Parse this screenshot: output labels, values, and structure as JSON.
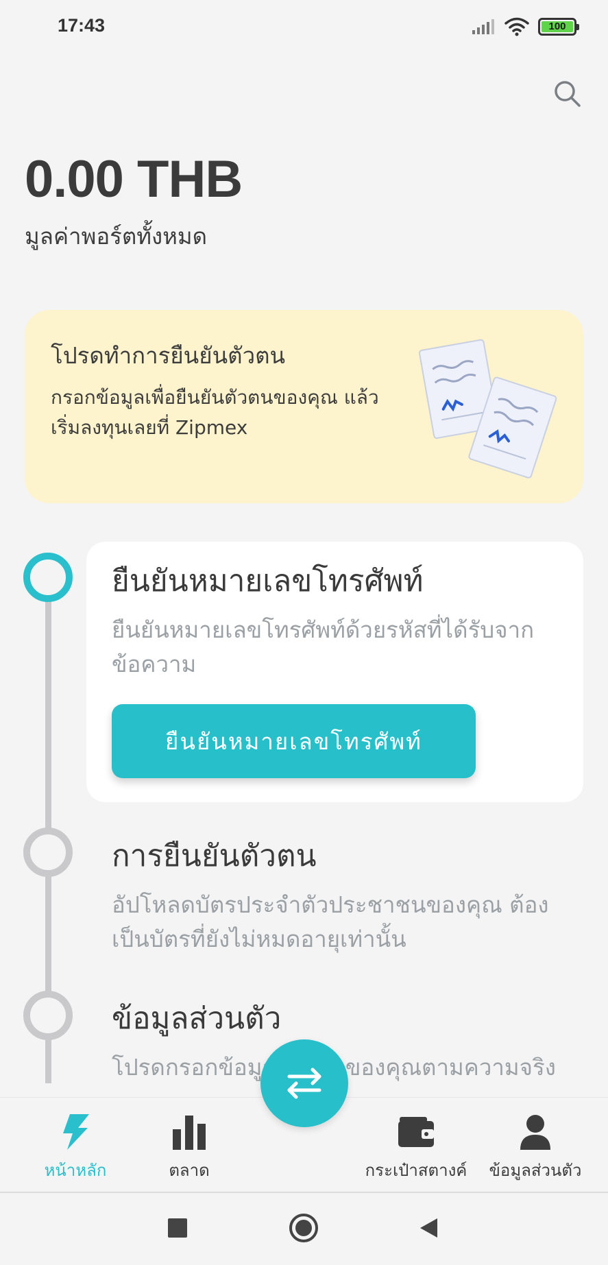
{
  "status_bar": {
    "time": "17:43",
    "battery": "100",
    "icons": [
      "signal-icon",
      "wifi-icon",
      "battery-icon"
    ]
  },
  "header": {
    "search_icon": "search-icon"
  },
  "portfolio": {
    "balance": "0.00 THB",
    "label": "มูลค่าพอร์ตทั้งหมด"
  },
  "kyc_banner": {
    "title": "โปรดทำการยืนยันตัวตน",
    "description": "กรอกข้อมูลเพื่อยืนยันตัวตนของคุณ แล้วเริ่มลงทุนเลยที่ Zipmex",
    "illustration": "documents-icon"
  },
  "steps": [
    {
      "title": "ยืนยันหมายเลขโทรศัพท์",
      "description": "ยืนยันหมายเลขโทรศัพท์ด้วยรหัสที่ได้รับจากข้อความ",
      "button_label": "ยืนยันหมายเลขโทรศัพท์",
      "active": true
    },
    {
      "title": "การยืนยันตัวตน",
      "description": "อัปโหลดบัตรประจำตัวประชาชนของคุณ ต้องเป็นบัตรที่ยังไม่หมดอายุเท่านั้น",
      "active": false
    },
    {
      "title": "ข้อมูลส่วนตัว",
      "description": "โปรดกรอกข้อมูลส่วนตัวของคุณตามความจริง",
      "active": false
    }
  ],
  "bottom_nav": {
    "items": [
      {
        "label": "หน้าหลัก",
        "icon": "lightning-icon",
        "active": true
      },
      {
        "label": "ตลาด",
        "icon": "bar-chart-icon",
        "active": false
      },
      {
        "label": "กระเป๋าสตางค์",
        "icon": "wallet-icon",
        "active": false
      },
      {
        "label": "ข้อมูลส่วนตัว",
        "icon": "person-icon",
        "active": false
      }
    ],
    "fab_icon": "swap-arrows-icon"
  },
  "colors": {
    "accent": "#26bfca",
    "banner": "#fdf3cd",
    "background": "#f4f4f5",
    "muted_text": "#9aa0a4",
    "timeline": "#c9c9cb"
  }
}
